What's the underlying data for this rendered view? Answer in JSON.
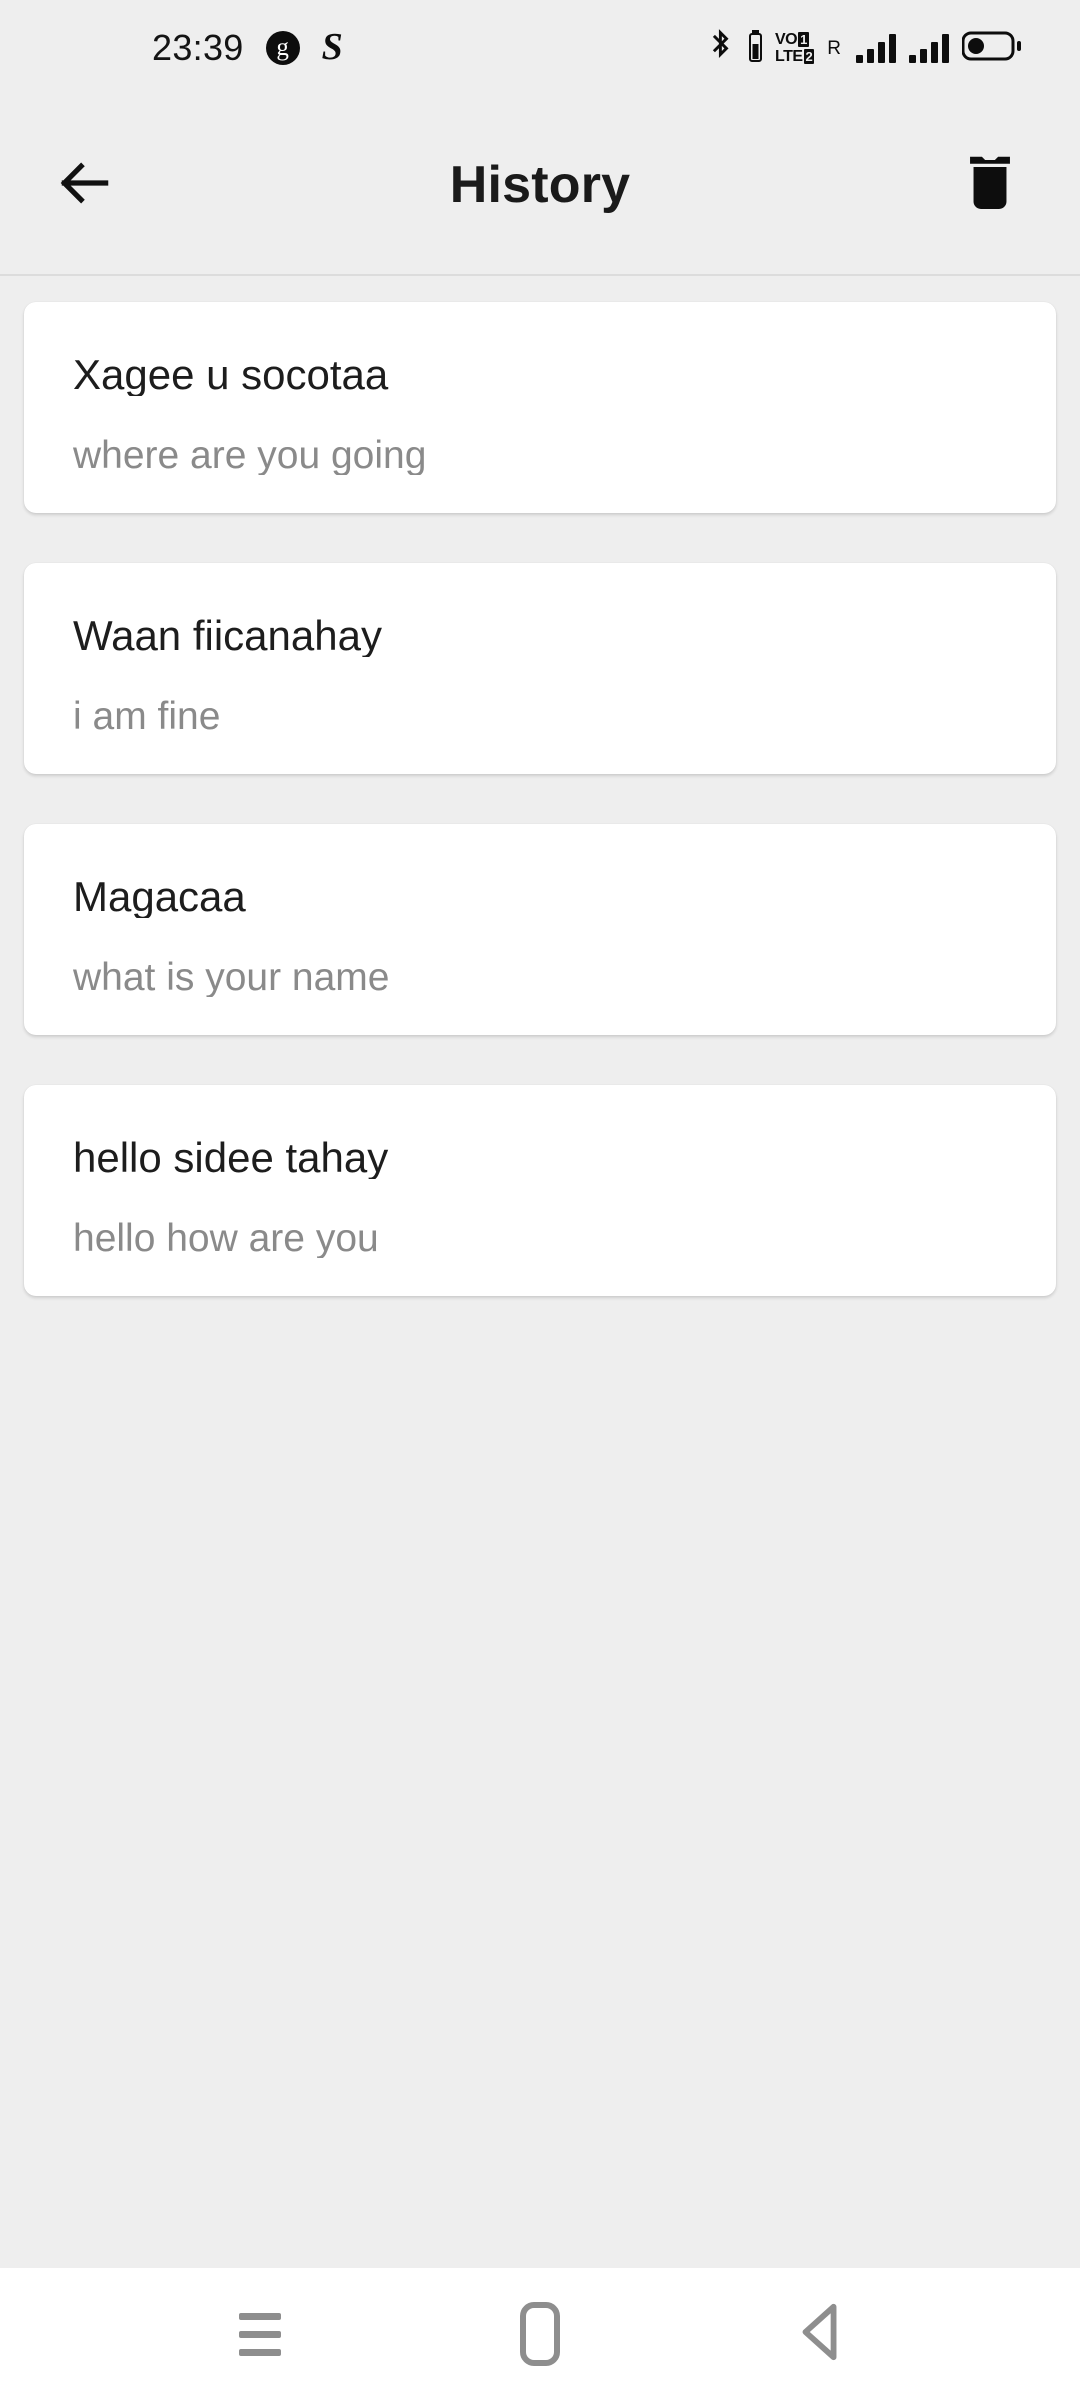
{
  "status_bar": {
    "clock": "23:39",
    "notifications": [
      {
        "name": "g-badge-icon",
        "glyph": "g"
      },
      {
        "name": "s-app-icon",
        "glyph": "S"
      }
    ],
    "icons": {
      "bluetooth": "bluetooth-icon",
      "bluetooth_battery": "bluetooth-battery-icon",
      "volte_line1": "VO",
      "volte_line2": "LTE",
      "sim1_badge": "1",
      "sim2_badge": "2",
      "roaming": "R",
      "signal_one": "signal-bars-icon",
      "signal_two": "signal-bars-icon",
      "battery": "battery-icon"
    },
    "signal_one_bars": 4,
    "signal_two_bars": 4,
    "battery_level_percent": 30
  },
  "app_bar": {
    "back_label": "back-arrow-icon",
    "title": "History",
    "delete_label": "delete-icon"
  },
  "history": {
    "items": [
      {
        "source": "Xagee u socotaa",
        "translation": "where are you going"
      },
      {
        "source": "Waan fiicanahay",
        "translation": "i am fine"
      },
      {
        "source": "Magacaa",
        "translation": "what is your name"
      },
      {
        "source": "hello sidee tahay",
        "translation": "hello how are you"
      }
    ]
  },
  "nav_bar": {
    "recents": "recents-icon",
    "home": "home-icon",
    "back": "back-icon"
  },
  "colors": {
    "background": "#eeeeee",
    "card": "#ffffff",
    "source_text": "#1d1d1d",
    "translation_text": "#8a8a8a",
    "title_text": "#1a1a1a",
    "nav_icon": "#8e8e8e",
    "divider": "#dcdcdc"
  }
}
